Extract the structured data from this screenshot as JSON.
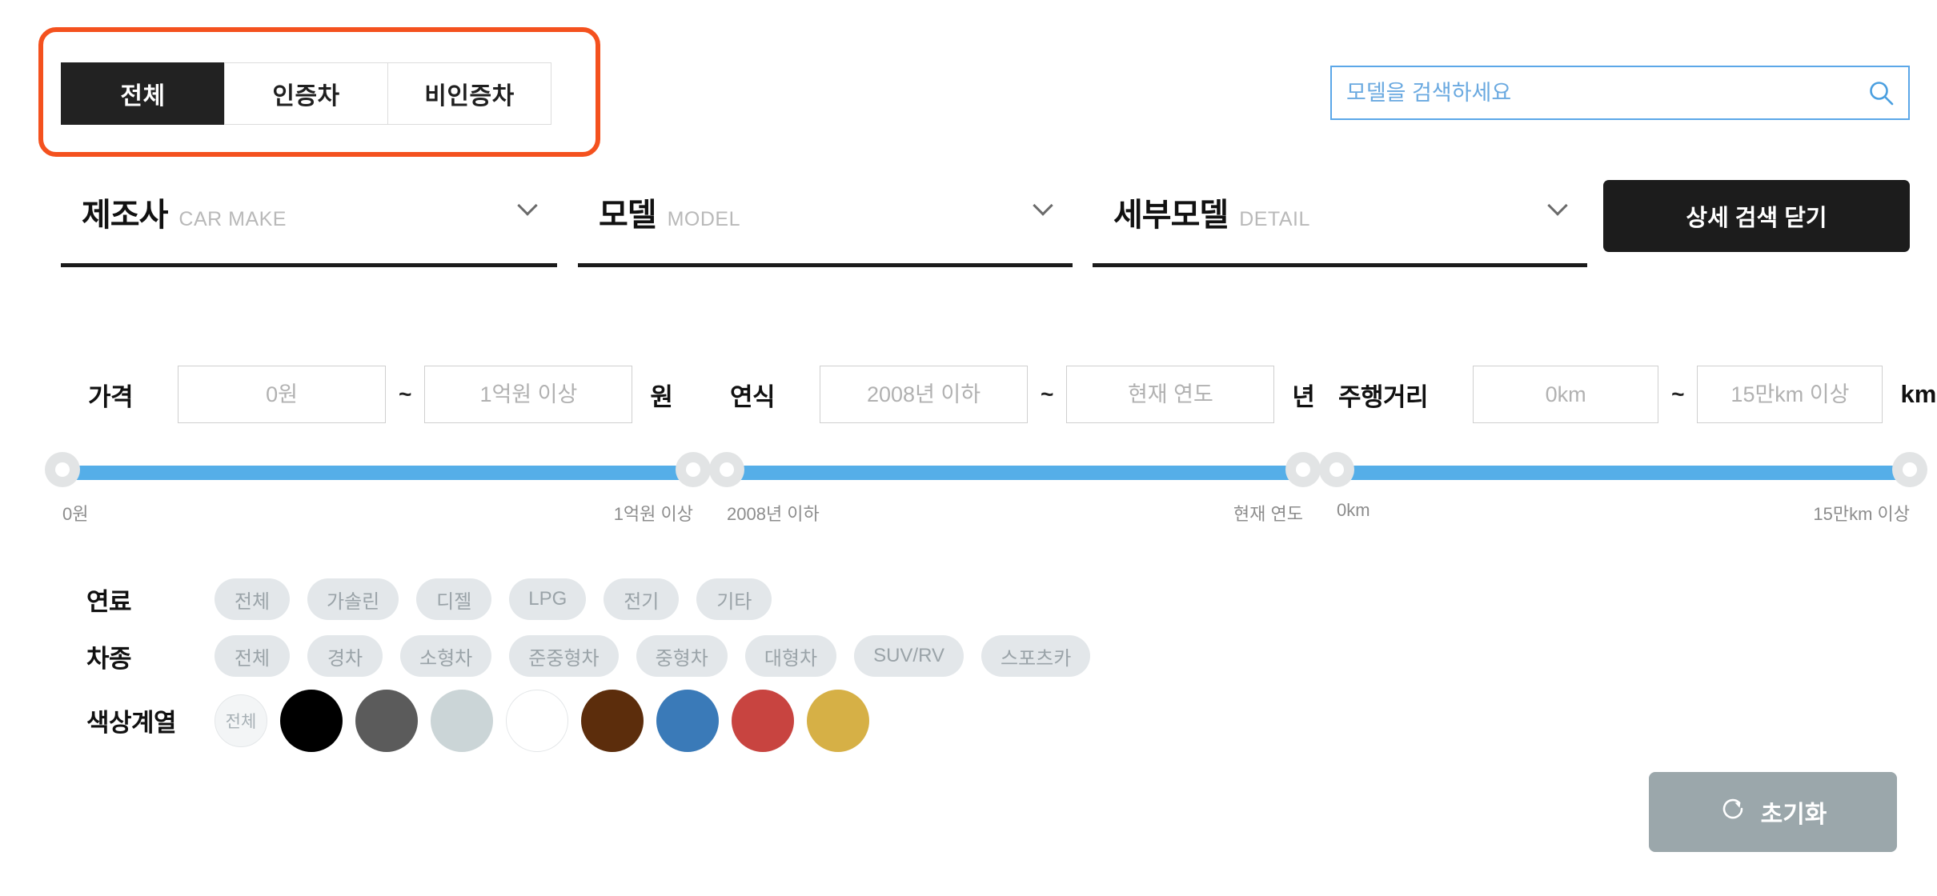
{
  "tabs": {
    "items": [
      {
        "label": "전체",
        "active": true
      },
      {
        "label": "인증차",
        "active": false
      },
      {
        "label": "비인증차",
        "active": false
      }
    ],
    "highlight_color": "#F4511E",
    "active_bg": "#222222"
  },
  "search": {
    "placeholder": "모델을 검색하세요",
    "value": "",
    "icon": "search-icon",
    "border_color": "#5BA7E8"
  },
  "selects": [
    {
      "label": "제조사",
      "sub": "CAR MAKE",
      "value": ""
    },
    {
      "label": "모델",
      "sub": "MODEL",
      "value": ""
    },
    {
      "label": "세부모델",
      "sub": "DETAIL",
      "value": ""
    }
  ],
  "close_detail_button": {
    "label": "상세 검색 닫기"
  },
  "ranges": [
    {
      "label": "가격",
      "min_placeholder": "0원",
      "max_placeholder": "1억원 이상",
      "min_value": "",
      "max_value": "",
      "separator": "~",
      "unit": "원",
      "slider": {
        "left_cap": "0원",
        "right_cap": "1억원 이상",
        "left_pct": 0,
        "right_pct": 100
      }
    },
    {
      "label": "연식",
      "min_placeholder": "2008년 이하",
      "max_placeholder": "현재 연도",
      "min_value": "",
      "max_value": "",
      "separator": "~",
      "unit": "년",
      "slider": {
        "left_cap": "2008년 이하",
        "right_cap": "현재 연도",
        "left_pct": 0,
        "right_pct": 100
      }
    },
    {
      "label": "주행거리",
      "min_placeholder": "0km",
      "max_placeholder": "15만km 이상",
      "min_value": "",
      "max_value": "",
      "separator": "~",
      "unit": "km",
      "slider": {
        "left_cap": "0km",
        "right_cap": "15만km 이상",
        "left_pct": 0,
        "right_pct": 100
      }
    }
  ],
  "fuel": {
    "label": "연료",
    "options": [
      "전체",
      "가솔린",
      "디젤",
      "LPG",
      "전기",
      "기타"
    ],
    "selected": []
  },
  "cartype": {
    "label": "차종",
    "options": [
      "전체",
      "경차",
      "소형차",
      "준중형차",
      "중형차",
      "대형차",
      "SUV/RV",
      "스포츠카"
    ],
    "selected": []
  },
  "color": {
    "label": "색상계열",
    "all_label": "전체",
    "swatches": [
      {
        "name": "black",
        "hex": "#000000"
      },
      {
        "name": "gray",
        "hex": "#5B5B5B"
      },
      {
        "name": "silver",
        "hex": "#CBD5D7"
      },
      {
        "name": "white",
        "hex": "#FFFFFF"
      },
      {
        "name": "brown",
        "hex": "#5C2D0C"
      },
      {
        "name": "blue",
        "hex": "#3A7AB8"
      },
      {
        "name": "red",
        "hex": "#C84440"
      },
      {
        "name": "gold",
        "hex": "#D6B046"
      }
    ]
  },
  "reset_button": {
    "label": "초기화",
    "icon": "refresh-icon",
    "bg": "#9BA7AB"
  }
}
